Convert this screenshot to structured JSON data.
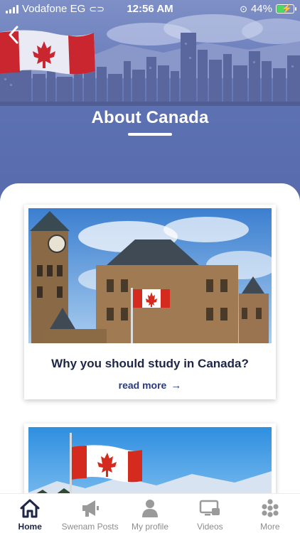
{
  "status_bar": {
    "carrier": "Vodafone EG",
    "time": "12:56 AM",
    "battery": "44%"
  },
  "header": {
    "title": "About Canada"
  },
  "cards": [
    {
      "title": "Why you should study in Canada?",
      "link_label": "read more"
    }
  ],
  "tabs": [
    {
      "label": "Home",
      "icon": "home-icon",
      "active": true
    },
    {
      "label": "Swenam Posts",
      "icon": "megaphone-icon",
      "active": false
    },
    {
      "label": "My profile",
      "icon": "user-icon",
      "active": false
    },
    {
      "label": "Videos",
      "icon": "video-icon",
      "active": false
    },
    {
      "label": "More",
      "icon": "dots-grid-icon",
      "active": false
    }
  ],
  "colors": {
    "hero_blue": "#6375b3",
    "title_navy": "#1d2647",
    "link_navy": "#2a3a7a",
    "flag_red": "#d52b1e"
  }
}
